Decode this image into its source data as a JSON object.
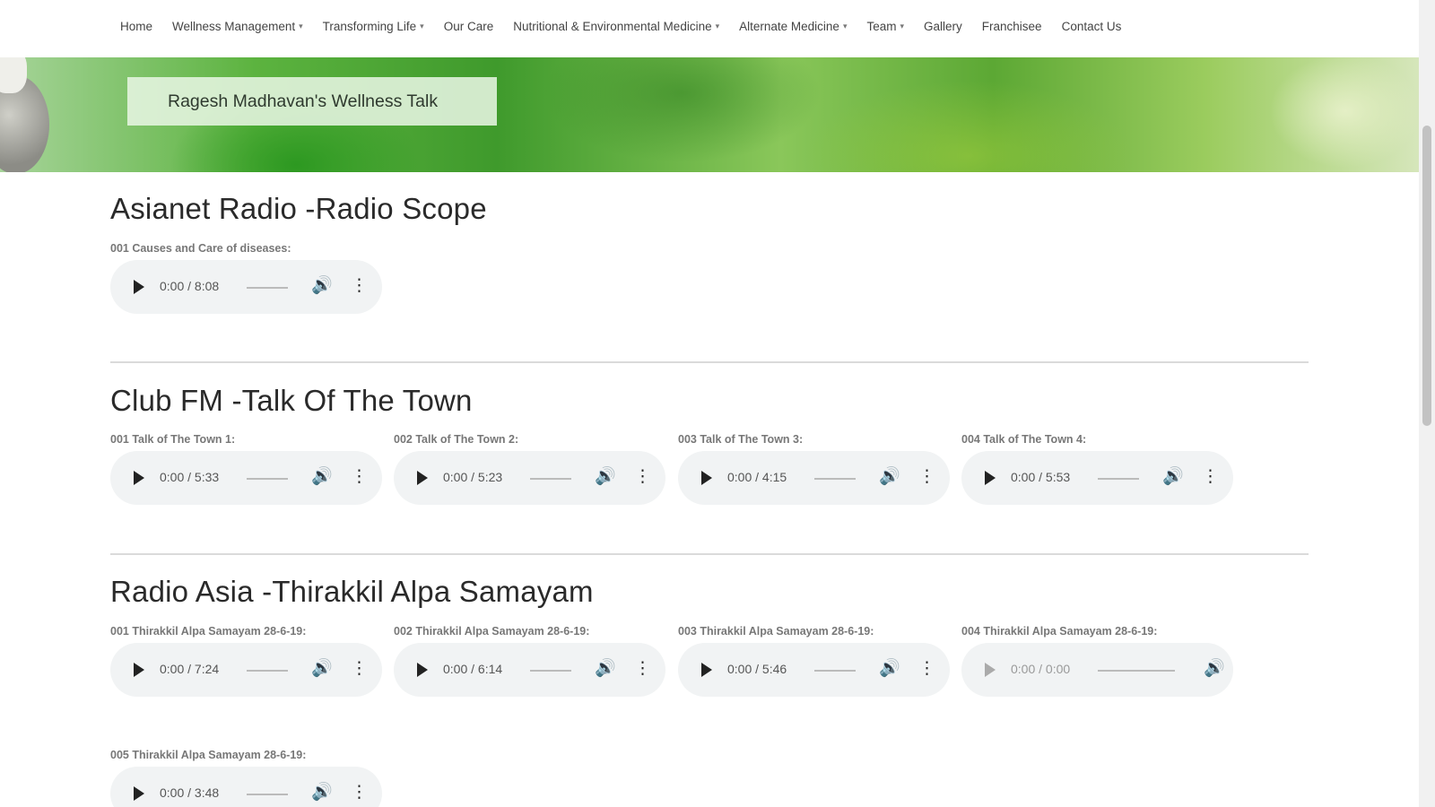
{
  "nav": {
    "items": [
      {
        "label": "Home",
        "dropdown": false
      },
      {
        "label": "Wellness Management",
        "dropdown": true
      },
      {
        "label": "Transforming Life",
        "dropdown": true
      },
      {
        "label": "Our Care",
        "dropdown": false
      },
      {
        "label": "Nutritional & Environmental Medicine",
        "dropdown": true
      },
      {
        "label": "Alternate Medicine",
        "dropdown": true
      },
      {
        "label": "Team",
        "dropdown": true
      },
      {
        "label": "Gallery",
        "dropdown": false
      },
      {
        "label": "Franchisee",
        "dropdown": false
      },
      {
        "label": "Contact Us",
        "dropdown": false
      }
    ]
  },
  "banner": {
    "title": "Ragesh Madhavan's Wellness Talk"
  },
  "sections": [
    {
      "title": "Asianet Radio -Radio Scope",
      "tracks": [
        {
          "label": "001 Causes and Care of diseases:",
          "time": "0:00 / 8:08",
          "disabled": false
        }
      ]
    },
    {
      "title": "Club FM -Talk Of The Town",
      "tracks": [
        {
          "label": "001 Talk of The Town 1:",
          "time": "0:00 / 5:33",
          "disabled": false
        },
        {
          "label": "002 Talk of The Town 2:",
          "time": "0:00 / 5:23",
          "disabled": false
        },
        {
          "label": "003 Talk of The Town 3:",
          "time": "0:00 / 4:15",
          "disabled": false
        },
        {
          "label": "004 Talk of The Town 4:",
          "time": "0:00 / 5:53",
          "disabled": false
        }
      ]
    },
    {
      "title": "Radio Asia -Thirakkil Alpa Samayam",
      "tracks": [
        {
          "label": "001 Thirakkil Alpa Samayam 28-6-19:",
          "time": "0:00 / 7:24",
          "disabled": false
        },
        {
          "label": "002 Thirakkil Alpa Samayam 28-6-19:",
          "time": "0:00 / 6:14",
          "disabled": false
        },
        {
          "label": "003 Thirakkil Alpa Samayam 28-6-19:",
          "time": "0:00 / 5:46",
          "disabled": false
        },
        {
          "label": "004 Thirakkil Alpa Samayam 28-6-19:",
          "time": "0:00 / 0:00",
          "disabled": true
        },
        {
          "label": "005 Thirakkil Alpa Samayam 28-6-19:",
          "time": "0:00 / 3:48",
          "disabled": false
        }
      ]
    }
  ],
  "icons": {
    "play": "play-icon",
    "volume": "volume-icon",
    "more": "more-options-icon"
  }
}
